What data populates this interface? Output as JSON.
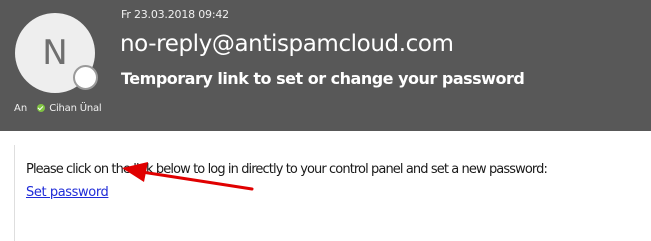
{
  "email": {
    "date": "Fr 23.03.2018 09:42",
    "avatar_initial": "N",
    "sender": "no-reply@antispamcloud.com",
    "subject": "Temporary link to set or change your password",
    "to_label": "An",
    "recipient": "Cihan Ünal"
  },
  "body": {
    "message": "Please click on the link below to log in directly to your control panel and set a new password:",
    "link_label": "Set password"
  },
  "colors": {
    "header_bg": "#585858",
    "link": "#1f2bd8",
    "arrow": "#e00000",
    "presence_ok": "#80c342"
  },
  "icons": {
    "avatar": "avatar",
    "presence": "presence-icon",
    "recipient_status": "check-icon",
    "annotation": "arrow-icon"
  }
}
